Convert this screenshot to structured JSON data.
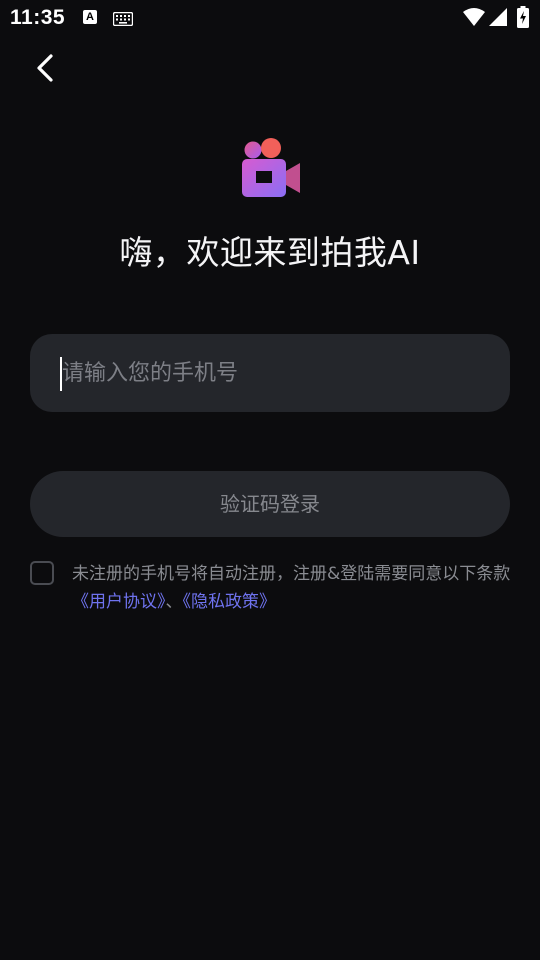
{
  "status_bar": {
    "time": "11:35",
    "notification_icon_letter": "A",
    "icons": [
      "a-notification-icon",
      "keyboard-icon",
      "wifi-icon",
      "signal-icon",
      "battery-charging-icon"
    ]
  },
  "header": {
    "back_icon": "chevron-left-icon"
  },
  "logo": {
    "icon": "video-camera-logo-icon",
    "colors": [
      "#f05a6e",
      "#b85ef0",
      "#8b6cf5"
    ]
  },
  "welcome": {
    "title": "嗨，欢迎来到拍我AI"
  },
  "phone": {
    "placeholder": "请输入您的手机号",
    "value": ""
  },
  "login": {
    "label": "验证码登录"
  },
  "agreement": {
    "checked": false,
    "text_before": "未注册的手机号将自动注册，注册&登陆需要同意以下条款",
    "user_agreement": "《用户协议》",
    "separator": "、",
    "privacy_policy": "《隐私政策》",
    "link_color": "#6f73ef"
  },
  "colors": {
    "background": "#0c0c0e",
    "surface": "#24262b",
    "muted_text": "#8a8c92"
  }
}
